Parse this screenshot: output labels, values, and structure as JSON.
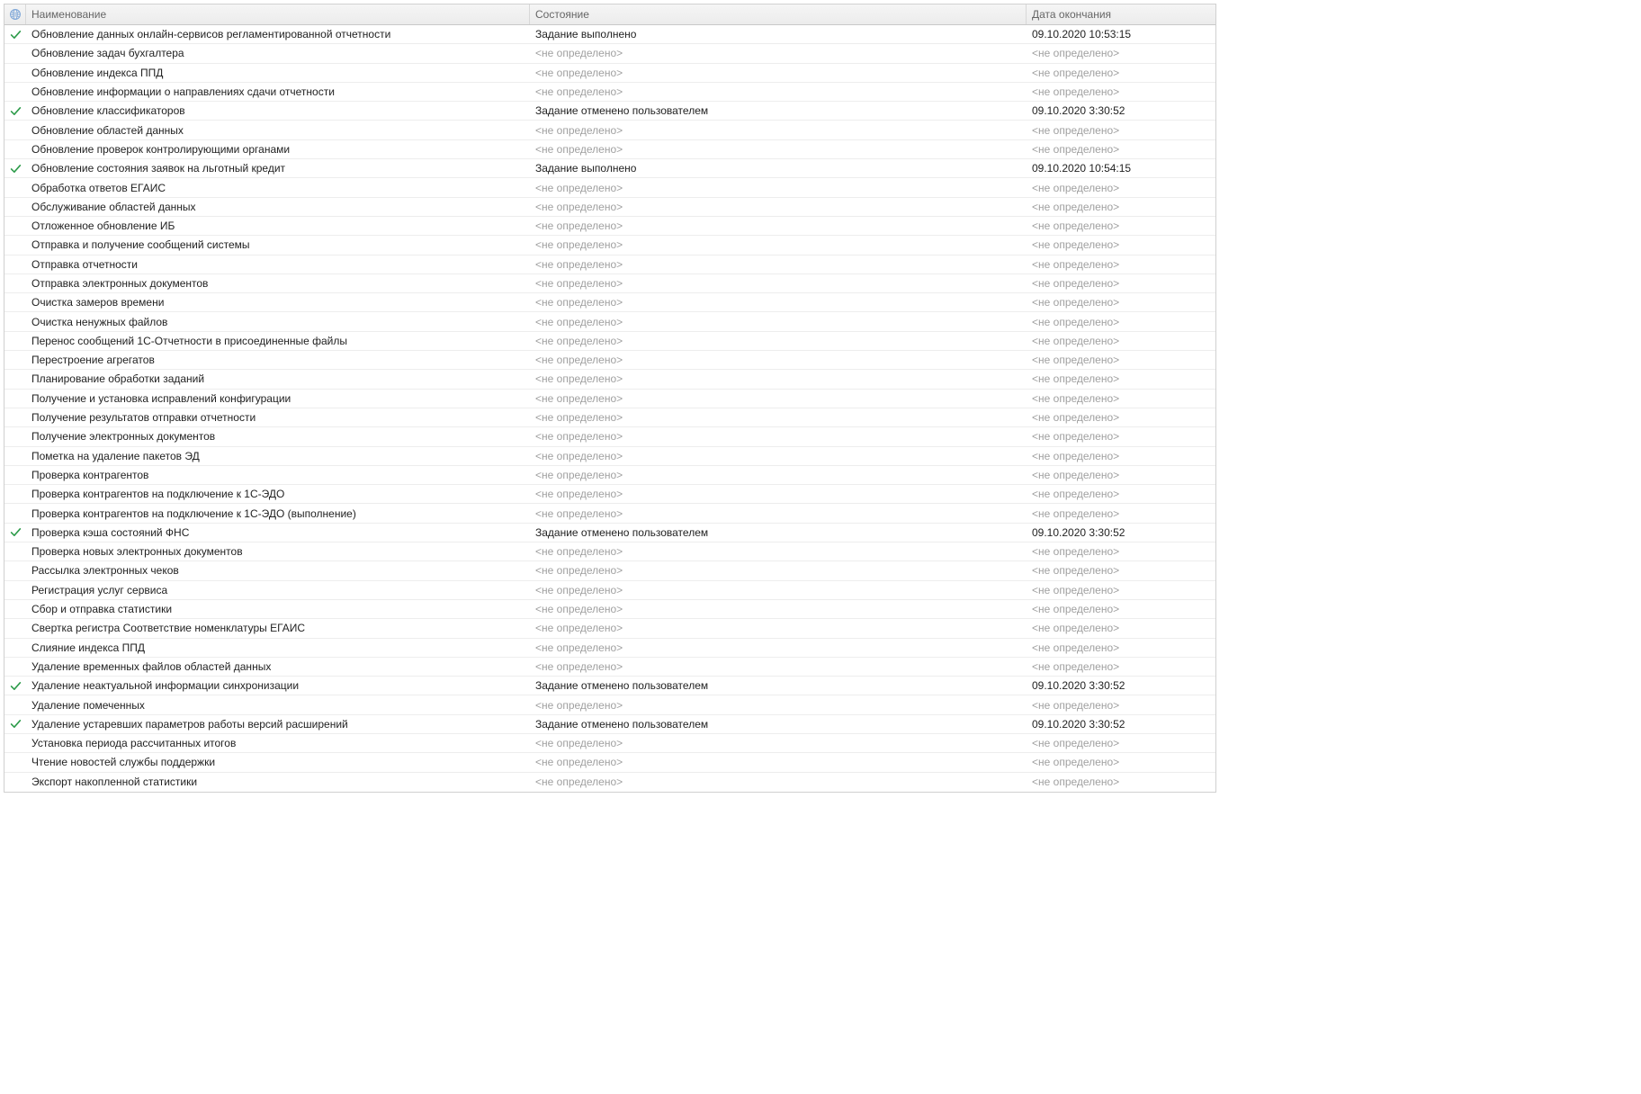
{
  "columns": {
    "icon": "",
    "name": "Наименование",
    "state": "Состояние",
    "date": "Дата окончания"
  },
  "placeholders": {
    "undefined": "<не определено>"
  },
  "rows": [
    {
      "checked": true,
      "name": "Обновление данных онлайн-сервисов регламентированной отчетности",
      "state": "Задание выполнено",
      "date": "09.10.2020 10:53:15"
    },
    {
      "checked": false,
      "name": "Обновление задач бухгалтера",
      "state": null,
      "date": null
    },
    {
      "checked": false,
      "name": "Обновление индекса ППД",
      "state": null,
      "date": null
    },
    {
      "checked": false,
      "name": "Обновление информации о направлениях сдачи отчетности",
      "state": null,
      "date": null
    },
    {
      "checked": true,
      "name": "Обновление классификаторов",
      "state": "Задание отменено пользователем",
      "date": "09.10.2020 3:30:52"
    },
    {
      "checked": false,
      "name": "Обновление областей данных",
      "state": null,
      "date": null
    },
    {
      "checked": false,
      "name": "Обновление проверок контролирующими органами",
      "state": null,
      "date": null
    },
    {
      "checked": true,
      "name": "Обновление состояния заявок на льготный кредит",
      "state": "Задание выполнено",
      "date": "09.10.2020 10:54:15"
    },
    {
      "checked": false,
      "name": "Обработка ответов ЕГАИС",
      "state": null,
      "date": null
    },
    {
      "checked": false,
      "name": "Обслуживание областей данных",
      "state": null,
      "date": null
    },
    {
      "checked": false,
      "name": "Отложенное обновление ИБ",
      "state": null,
      "date": null
    },
    {
      "checked": false,
      "name": "Отправка и получение сообщений системы",
      "state": null,
      "date": null
    },
    {
      "checked": false,
      "name": "Отправка отчетности",
      "state": null,
      "date": null
    },
    {
      "checked": false,
      "name": "Отправка электронных документов",
      "state": null,
      "date": null
    },
    {
      "checked": false,
      "name": "Очистка замеров времени",
      "state": null,
      "date": null
    },
    {
      "checked": false,
      "name": "Очистка ненужных файлов",
      "state": null,
      "date": null
    },
    {
      "checked": false,
      "name": "Перенос сообщений 1С-Отчетности в присоединенные файлы",
      "state": null,
      "date": null
    },
    {
      "checked": false,
      "name": "Перестроение агрегатов",
      "state": null,
      "date": null
    },
    {
      "checked": false,
      "name": "Планирование обработки заданий",
      "state": null,
      "date": null
    },
    {
      "checked": false,
      "name": "Получение и установка исправлений конфигурации",
      "state": null,
      "date": null
    },
    {
      "checked": false,
      "name": "Получение результатов отправки отчетности",
      "state": null,
      "date": null
    },
    {
      "checked": false,
      "name": "Получение электронных документов",
      "state": null,
      "date": null
    },
    {
      "checked": false,
      "name": "Пометка на удаление пакетов ЭД",
      "state": null,
      "date": null
    },
    {
      "checked": false,
      "name": "Проверка контрагентов",
      "state": null,
      "date": null
    },
    {
      "checked": false,
      "name": "Проверка контрагентов на подключение к 1С-ЭДО",
      "state": null,
      "date": null
    },
    {
      "checked": false,
      "name": "Проверка контрагентов на подключение к 1С-ЭДО (выполнение)",
      "state": null,
      "date": null
    },
    {
      "checked": true,
      "name": "Проверка кэша состояний ФНС",
      "state": "Задание отменено пользователем",
      "date": "09.10.2020 3:30:52"
    },
    {
      "checked": false,
      "name": "Проверка новых электронных документов",
      "state": null,
      "date": null
    },
    {
      "checked": false,
      "name": "Рассылка электронных чеков",
      "state": null,
      "date": null
    },
    {
      "checked": false,
      "name": "Регистрация услуг сервиса",
      "state": null,
      "date": null
    },
    {
      "checked": false,
      "name": "Сбор и отправка статистики",
      "state": null,
      "date": null
    },
    {
      "checked": false,
      "name": "Свертка регистра Соответствие номенклатуры ЕГАИС",
      "state": null,
      "date": null
    },
    {
      "checked": false,
      "name": "Слияние индекса ППД",
      "state": null,
      "date": null
    },
    {
      "checked": false,
      "name": "Удаление временных файлов областей данных",
      "state": null,
      "date": null
    },
    {
      "checked": true,
      "name": "Удаление неактуальной информации синхронизации",
      "state": "Задание отменено пользователем",
      "date": "09.10.2020 3:30:52"
    },
    {
      "checked": false,
      "name": "Удаление помеченных",
      "state": null,
      "date": null
    },
    {
      "checked": true,
      "name": "Удаление устаревших параметров работы версий расширений",
      "state": "Задание отменено пользователем",
      "date": "09.10.2020 3:30:52"
    },
    {
      "checked": false,
      "name": "Установка периода рассчитанных итогов",
      "state": null,
      "date": null
    },
    {
      "checked": false,
      "name": "Чтение новостей службы поддержки",
      "state": null,
      "date": null
    },
    {
      "checked": false,
      "name": "Экспорт накопленной статистики",
      "state": null,
      "date": null
    }
  ]
}
